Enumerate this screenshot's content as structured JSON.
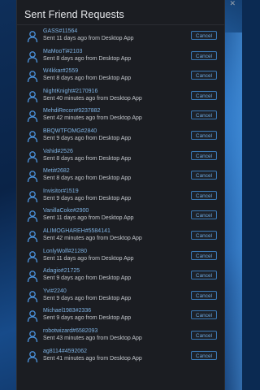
{
  "window": {
    "title": "Sent Friend Requests",
    "cancel_label": "Cancel",
    "controls": [
      "—",
      "□",
      "✕"
    ]
  },
  "requests": [
    {
      "name": "GASS#11564",
      "status": "Sent 11 days ago from Desktop App"
    },
    {
      "name": "MaMooTi#2103",
      "status": "Sent 8 days ago from Desktop App"
    },
    {
      "name": "W4kkar#2559",
      "status": "Sent 8 days ago from Desktop App"
    },
    {
      "name": "NightKnight#2170916",
      "status": "Sent 40 minutes ago from Desktop App"
    },
    {
      "name": "MehdiRecon#9237882",
      "status": "Sent 42 minutes ago from Desktop App"
    },
    {
      "name": "BBQWTFOMG#2840",
      "status": "Sent 9 days ago from Desktop App"
    },
    {
      "name": "Vahid#2526",
      "status": "Sent 8 days ago from Desktop App"
    },
    {
      "name": "Meti#2682",
      "status": "Sent 8 days ago from Desktop App"
    },
    {
      "name": "Invisitor#1519",
      "status": "Sent 9 days ago from Desktop App"
    },
    {
      "name": "VanillaCoke#2900",
      "status": "Sent 11 days ago from Desktop App"
    },
    {
      "name": "ALIMOGHAREH#5584141",
      "status": "Sent 42 minutes ago from Desktop App"
    },
    {
      "name": "LonlyWolf#21280",
      "status": "Sent 11 days ago from Desktop App"
    },
    {
      "name": "Adagio#21725",
      "status": "Sent 9 days ago from Desktop App"
    },
    {
      "name": "Yvi#2240",
      "status": "Sent 9 days ago from Desktop App"
    },
    {
      "name": "Michael1983#2336",
      "status": "Sent 9 days ago from Desktop App"
    },
    {
      "name": "robotwizard#6582093",
      "status": "Sent 43 minutes ago from Desktop App"
    },
    {
      "name": "ag8114#4592062",
      "status": "Sent 41 minutes ago from Desktop App"
    }
  ],
  "colors": {
    "accent": "#3a78b4",
    "name_text": "#7fb3e3",
    "window_bg": "#1b1d22"
  },
  "icons": {
    "avatar": "user-silhouette-icon"
  }
}
